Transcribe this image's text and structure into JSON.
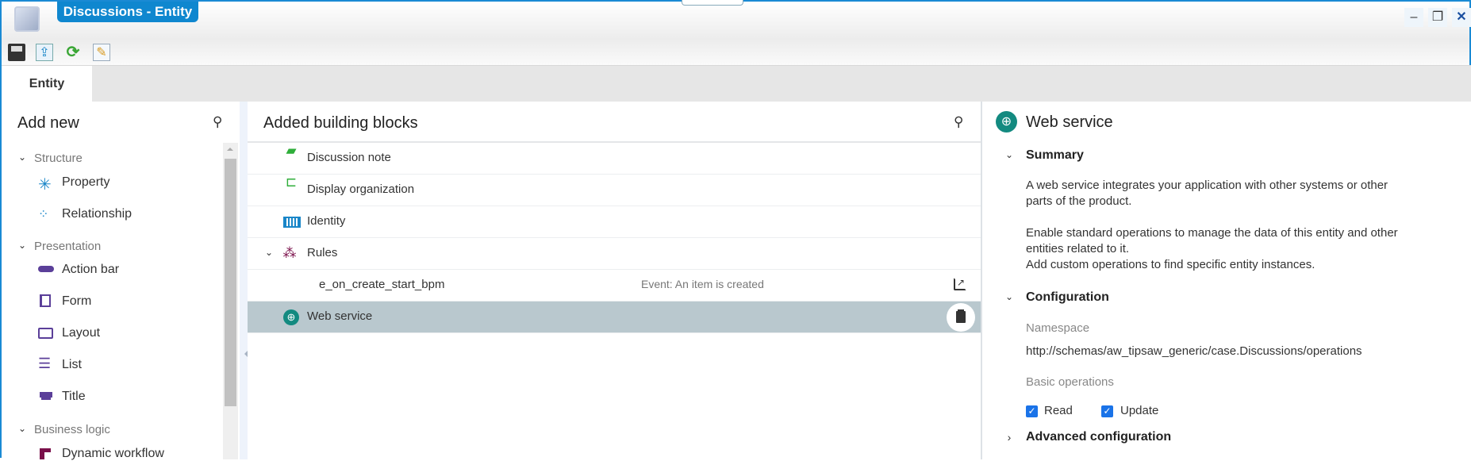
{
  "window": {
    "title": "Discussions - Entity",
    "controls": {
      "minimize": "–",
      "restore": "❐",
      "close": "✕"
    }
  },
  "toolbar": {
    "icons": [
      "save-icon",
      "publish-icon",
      "refresh-icon",
      "edit-icon"
    ]
  },
  "tabs": [
    {
      "label": "Entity",
      "active": true
    }
  ],
  "left_panel": {
    "title": "Add new",
    "groups": [
      {
        "label": "Structure",
        "items": [
          {
            "label": "Property",
            "color": "#1a86c8"
          },
          {
            "label": "Relationship",
            "color": "#1a86c8"
          }
        ]
      },
      {
        "label": "Presentation",
        "items": [
          {
            "label": "Action bar",
            "color": "#5b3f99"
          },
          {
            "label": "Form",
            "color": "#5b3f99"
          },
          {
            "label": "Layout",
            "color": "#5b3f99"
          },
          {
            "label": "List",
            "color": "#5b3f99"
          },
          {
            "label": "Title",
            "color": "#5b3f99"
          }
        ]
      },
      {
        "label": "Business logic",
        "items": [
          {
            "label": "Dynamic workflow",
            "color": "#7a0f4a"
          }
        ]
      }
    ]
  },
  "middle_panel": {
    "title": "Added building blocks",
    "rows": [
      {
        "label": "Discussion note",
        "icon": "discussion-note-icon"
      },
      {
        "label": "Display organization",
        "icon": "display-organization-icon"
      },
      {
        "label": "Identity",
        "icon": "identity-icon"
      },
      {
        "label": "Rules",
        "icon": "rules-icon",
        "expanded": true
      },
      {
        "label": "e_on_create_start_bpm",
        "event": "Event: An item is created"
      },
      {
        "label": "Web service",
        "icon": "web-service-icon",
        "selected": true
      }
    ]
  },
  "right_panel": {
    "title": "Web service",
    "summary": {
      "heading": "Summary",
      "p1": "A web service integrates your application with other systems or other",
      "p1b": "parts of the product.",
      "p2": "Enable standard operations to manage the data of this entity and other",
      "p2b": "entities related to it.",
      "p3": "Add custom operations to find specific entity instances."
    },
    "configuration": {
      "heading": "Configuration",
      "namespace_label": "Namespace",
      "namespace_value": "http://schemas/aw_tipsaw_generic/case.Discussions/operations",
      "basic_ops_label": "Basic operations",
      "ops": [
        {
          "label": "Read",
          "checked": true
        },
        {
          "label": "Update",
          "checked": true
        }
      ]
    },
    "advanced": {
      "heading": "Advanced configuration"
    }
  },
  "colors": {
    "accent": "#0f87cf",
    "selected_row": "#b9c8ce",
    "checkbox": "#1a73e8",
    "teal": "#138a80"
  }
}
